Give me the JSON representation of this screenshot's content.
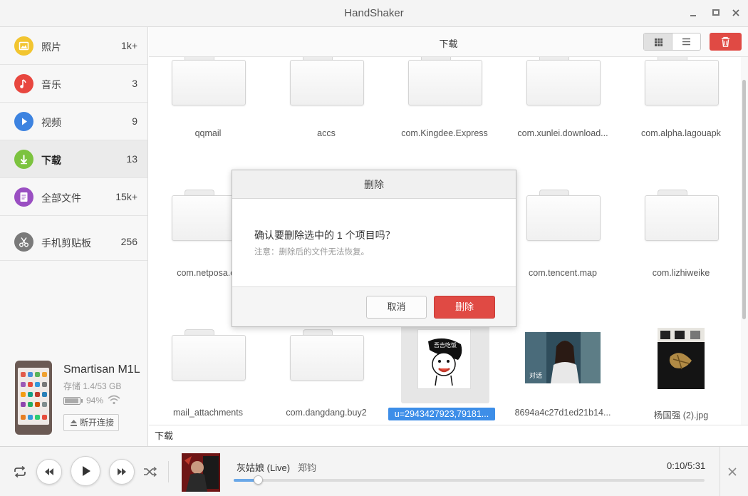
{
  "window": {
    "title": "HandShaker"
  },
  "sidebar": {
    "items": [
      {
        "label": "照片",
        "count": "1k+",
        "icon": "photo-icon",
        "color": "#f2c530"
      },
      {
        "label": "音乐",
        "count": "3",
        "icon": "music-icon",
        "color": "#e8473f"
      },
      {
        "label": "视频",
        "count": "9",
        "icon": "video-icon",
        "color": "#3d83e0"
      },
      {
        "label": "下载",
        "count": "13",
        "icon": "download-icon",
        "color": "#7cc33f"
      },
      {
        "label": "全部文件",
        "count": "15k+",
        "icon": "file-icon",
        "color": "#9a4fc2"
      },
      {
        "label": "手机剪贴板",
        "count": "256",
        "icon": "scissors-icon",
        "color": "#7a7a7a"
      }
    ]
  },
  "device": {
    "name": "Smartisan M1L",
    "storage": "存储 1.4/53 GB",
    "battery": "94%",
    "battery_level": 0.94,
    "disconnect_label": "断开连接"
  },
  "main": {
    "folder_title": "下载",
    "files": [
      {
        "name": "qqmail"
      },
      {
        "name": "accs"
      },
      {
        "name": "com.Kingdee.Express"
      },
      {
        "name": "com.xunlei.download..."
      },
      {
        "name": "com.alpha.lagouapk"
      },
      {
        "name": "com.netposa.cy"
      },
      {
        "name": ""
      },
      {
        "name": ""
      },
      {
        "name": "com.tencent.map"
      },
      {
        "name": "com.lizhiweike"
      },
      {
        "name": "mail_attachments"
      },
      {
        "name": "com.dangdang.buy2"
      },
      {
        "name": "u=2943427923,79181..."
      },
      {
        "name": "8694a4c27d1ed21b14..."
      },
      {
        "name": "杨国强 (2).jpg"
      }
    ],
    "path": "下载"
  },
  "dialog": {
    "title": "删除",
    "message": "确认要删除选中的 1 个项目吗？",
    "note": "注意：删除后的文件无法恢复。",
    "cancel_label": "取消",
    "confirm_label": "删除"
  },
  "player": {
    "song": "灰姑娘 (Live)",
    "artist": "郑钧",
    "time": "0:10/5:31",
    "progress": 0.031
  },
  "colors": {
    "accent": "#3d8ee8",
    "danger": "#e04a44"
  }
}
